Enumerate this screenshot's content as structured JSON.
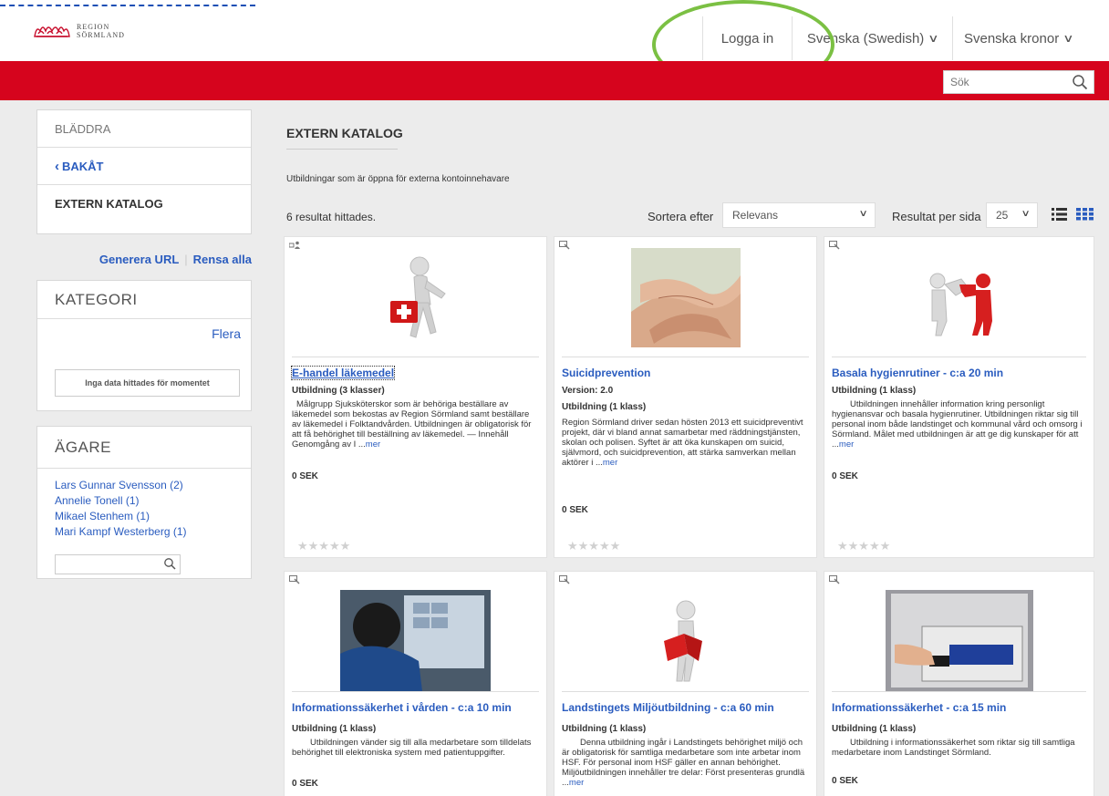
{
  "header": {
    "logo_line1": "Region",
    "logo_line2": "Sörmland",
    "login": "Logga in",
    "language": "Svenska (Swedish)",
    "currency": "Svenska kronor"
  },
  "search": {
    "placeholder": "Sök"
  },
  "sidebar": {
    "browse_title": "BLÄDDRA",
    "back": "BAKÅT",
    "current": "EXTERN KATALOG",
    "generate_url": "Generera URL",
    "clear_all": "Rensa alla",
    "category_title": "KATEGORI",
    "more": "Flera",
    "no_data": "Inga data hittades för momentet",
    "owner_title": "ÄGARE",
    "owners": [
      "Lars Gunnar Svensson (2)",
      "Annelie Tonell (1)",
      "Mikael Stenhem (1)",
      "Mari Kampf Westerberg (1)"
    ]
  },
  "main": {
    "title": "EXTERN KATALOG",
    "subtitle": "Utbildningar som är öppna för externa kontoinnehavare",
    "results": "6 resultat hittades.",
    "sort_label": "Sortera efter",
    "sort_value": "Relevans",
    "per_page_label": "Resultat per sida",
    "per_page_value": "25"
  },
  "cards": [
    {
      "title": "E-handel läkemedel",
      "meta1": "Utbildning (3 klasser)",
      "meta2": "",
      "desc": "Målgrupp  Sjuksköterskor som är behöriga beställare av läkemedel som bekostas av Region Sörmland samt beställare av läkemedel i Folktandvården. Utbildningen är obligatorisk för att få behörighet till beställning av läkemedel. — Innehåll  Genomgång av I ...",
      "more": "mer",
      "price": "0 SEK",
      "stars": "★★★★★",
      "icon": "person-figure-icon"
    },
    {
      "title": "Suicidprevention",
      "meta1": "Version:  2.0",
      "meta2": "Utbildning (1 klass)",
      "desc": "Region Sörmland driver sedan hösten 2013 ett suicidpreventivt projekt, där vi bland annat  samarbetar med räddningstjänsten, skolan och polisen. Syftet är att öka kunskapen om suicid,  självmord, och suicidprevention, att stärka samverkan mellan aktörer i ...",
      "more": "mer",
      "price": "0 SEK",
      "stars": "★★★★★",
      "icon": "monitor-icon"
    },
    {
      "title": "Basala hygienrutiner - c:a 20 min",
      "meta1": "Utbildning (1 klass)",
      "meta2": "",
      "desc": "Utbildningen innehåller information kring personligt hygienansvar och basala hygienrutiner.   Utbildningen riktar sig till personal inom både landstinget och kommunal vård och omsorg i Sörmland.  Målet med utbildningen är att ge dig kunskaper för att ...",
      "more": "mer",
      "price": "0 SEK",
      "stars": "★★★★★",
      "icon": "monitor-icon"
    },
    {
      "title": "Informationssäkerhet i vården - c:a 10 min",
      "meta1": "Utbildning (1 klass)",
      "meta2": "",
      "desc": "Utbildningen vänder sig till alla medarbetare som tilldelats behörighet till elektroniska system med patientuppgifter.",
      "more": "",
      "price": "0 SEK",
      "stars": "",
      "icon": "monitor-icon"
    },
    {
      "title": "Landstingets Miljöutbildning - c:a 60 min",
      "meta1": "Utbildning (1 klass)",
      "meta2": "",
      "desc": "Denna utbildning ingår i Landstingets behörighet miljö och är obligatorisk för samtliga medarbetare som inte arbetar inom HSF.  För personal inom HSF gäller en annan behörighet.  Miljöutbildningen innehåller tre delar:     Först presenteras grundlä ...",
      "more": "mer",
      "price": "",
      "stars": "",
      "icon": "monitor-icon"
    },
    {
      "title": "Informationssäkerhet - c:a 15 min",
      "meta1": "Utbildning (1 klass)",
      "meta2": "",
      "desc": "Utbildning i informationssäkerhet som riktar sig till samtliga medarbetare inom Landstinget Sörmland.",
      "more": "",
      "price": "0 SEK",
      "stars": "",
      "icon": "monitor-icon"
    }
  ]
}
